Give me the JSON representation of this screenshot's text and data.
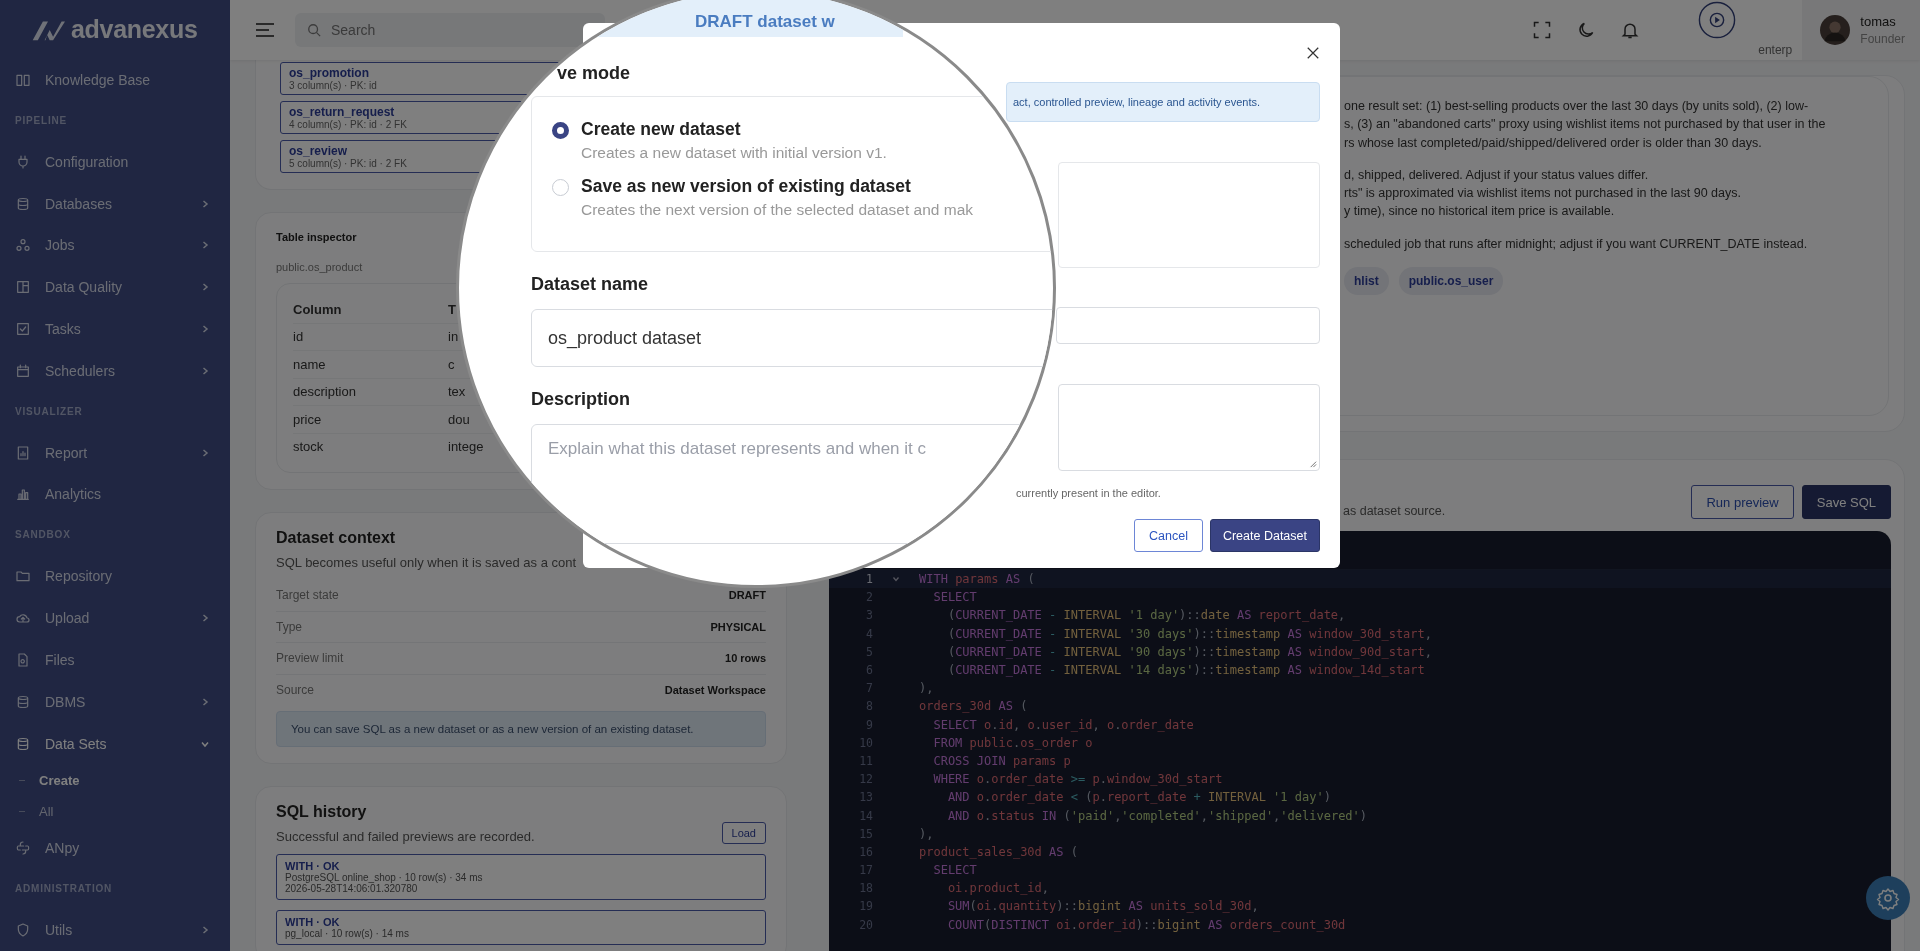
{
  "sidebar": {
    "logo": "advanexus",
    "items": [
      {
        "kind": "item",
        "label": "Knowledge Base",
        "submenu": false,
        "selected": false
      },
      {
        "kind": "section",
        "label": "PIPELINE"
      },
      {
        "kind": "item",
        "label": "Configuration",
        "submenu": false,
        "selected": false
      },
      {
        "kind": "item",
        "label": "Databases",
        "submenu": true,
        "expanded": false,
        "selected": false
      },
      {
        "kind": "item",
        "label": "Jobs",
        "submenu": true,
        "expanded": false,
        "selected": false
      },
      {
        "kind": "item",
        "label": "Data Quality",
        "submenu": true,
        "expanded": false,
        "selected": false
      },
      {
        "kind": "item",
        "label": "Tasks",
        "submenu": true,
        "expanded": false,
        "selected": false
      },
      {
        "kind": "item",
        "label": "Schedulers",
        "submenu": true,
        "expanded": false,
        "selected": false
      },
      {
        "kind": "section",
        "label": "VISUALIZER"
      },
      {
        "kind": "item",
        "label": "Report",
        "submenu": true,
        "expanded": false,
        "selected": false
      },
      {
        "kind": "item",
        "label": "Analytics",
        "submenu": false,
        "selected": false
      },
      {
        "kind": "section",
        "label": "SANDBOX"
      },
      {
        "kind": "item",
        "label": "Repository",
        "submenu": false,
        "selected": false
      },
      {
        "kind": "item",
        "label": "Upload",
        "submenu": true,
        "expanded": false,
        "selected": false
      },
      {
        "kind": "item",
        "label": "Files",
        "submenu": false,
        "selected": false
      },
      {
        "kind": "item",
        "label": "DBMS",
        "submenu": true,
        "expanded": false,
        "selected": false
      },
      {
        "kind": "item",
        "label": "Data Sets",
        "submenu": true,
        "expanded": true,
        "selected": true
      },
      {
        "kind": "subitem",
        "label": "Create",
        "selected": true
      },
      {
        "kind": "subitem",
        "label": "All",
        "selected": false
      },
      {
        "kind": "item",
        "label": "ANpy",
        "submenu": false,
        "selected": false
      },
      {
        "kind": "section",
        "label": "ADMINISTRATION"
      },
      {
        "kind": "item",
        "label": "Utils",
        "submenu": true,
        "expanded": false,
        "selected": false
      }
    ]
  },
  "topbar": {
    "search_placeholder": "Search",
    "plan": "enterp",
    "user": {
      "name": "tomas",
      "role": "Founder"
    }
  },
  "tables": [
    {
      "name": "os_promotion",
      "meta": "3 column(s) · PK: id"
    },
    {
      "name": "os_return_request",
      "meta": "4 column(s) · PK: id · 2 FK"
    },
    {
      "name": "os_review",
      "meta": "5 column(s) · PK: id · 2 FK"
    }
  ],
  "inspector": {
    "title": "Table inspector",
    "table": "public.os_product",
    "columns": [
      "Column",
      "T"
    ],
    "rows": [
      [
        "id",
        "in"
      ],
      [
        "name",
        "c"
      ],
      [
        "description",
        "tex"
      ],
      [
        "price",
        "dou"
      ],
      [
        "stock",
        "intege"
      ]
    ]
  },
  "context": {
    "title": "Dataset context",
    "text": "SQL becomes useful only when it is saved as a cont",
    "rows": [
      {
        "label": "Target state",
        "value": "DRAFT"
      },
      {
        "label": "Type",
        "value": "PHYSICAL"
      },
      {
        "label": "Preview limit",
        "value": "10 rows"
      },
      {
        "label": "Source",
        "value": "Dataset Workspace"
      }
    ],
    "note": "You can save SQL as a new dataset or as a new version of an existing dataset."
  },
  "history": {
    "title": "SQL history",
    "text": "Successful and failed previews are recorded.",
    "load": "Load",
    "entries": [
      {
        "title": "WITH · OK",
        "lines": [
          "PostgreSQL online_shop · 10 row(s) · 34 ms",
          "2026-05-28T14:06:01.320780"
        ]
      },
      {
        "title": "WITH · OK",
        "lines": [
          "pg_local · 10 row(s) · 14 ms"
        ]
      }
    ]
  },
  "description": {
    "paragraphs": [
      [
        "one result set: (1) best-selling products over the last 30 days (by units sold), (2) low-",
        "s, (3) an \"abandoned carts\" proxy using wishlist items not purchased by that user in the",
        "rs whose last completed/paid/shipped/delivered order is older than 30 days."
      ],
      [
        "d, shipped, delivered. Adjust if your status values differ.",
        "rts\" is approximated via wishlist items not purchased in the last 90 days.",
        "y time), since no historical item price is available."
      ],
      [
        "scheduled job that runs after midnight; adjust if you want CURRENT_DATE instead."
      ]
    ],
    "tags": [
      "hlist",
      "public.os_user"
    ]
  },
  "sql": {
    "text": "as dataset source.",
    "buttons": [
      {
        "label": "Run preview",
        "kind": "secondary"
      },
      {
        "label": "Save SQL",
        "kind": "primary"
      }
    ]
  },
  "editor": {
    "lines": [
      {
        "n": "1",
        "current": true,
        "seg": [
          {
            "kind": "keyword",
            "text": "WITH"
          },
          {
            "kind": "identifier",
            "text": " params"
          },
          {
            "kind": "keyword",
            "text": " AS"
          },
          {
            "kind": "punctuation",
            "text": " ("
          }
        ]
      },
      {
        "n": "2",
        "current": false,
        "seg": [
          {
            "kind": "keyword",
            "text": "  SELECT"
          }
        ]
      },
      {
        "n": "3",
        "current": false,
        "seg": [
          {
            "kind": "punctuation",
            "text": "    ("
          },
          {
            "kind": "keyword",
            "text": "CURRENT_DATE"
          },
          {
            "kind": "operator",
            "text": " - "
          },
          {
            "kind": "type",
            "text": "INTERVAL"
          },
          {
            "kind": "string",
            "text": " '1 day'"
          },
          {
            "kind": "punctuation",
            "text": ")::"
          },
          {
            "kind": "type",
            "text": "date"
          },
          {
            "kind": "keyword",
            "text": " AS"
          },
          {
            "kind": "identifier",
            "text": " report_date"
          },
          {
            "kind": "punctuation",
            "text": ","
          }
        ]
      },
      {
        "n": "4",
        "current": false,
        "seg": [
          {
            "kind": "punctuation",
            "text": "    ("
          },
          {
            "kind": "keyword",
            "text": "CURRENT_DATE"
          },
          {
            "kind": "operator",
            "text": " - "
          },
          {
            "kind": "type",
            "text": "INTERVAL"
          },
          {
            "kind": "string",
            "text": " '30 days'"
          },
          {
            "kind": "punctuation",
            "text": ")::"
          },
          {
            "kind": "type",
            "text": "timestamp"
          },
          {
            "kind": "keyword",
            "text": " AS"
          },
          {
            "kind": "identifier",
            "text": " window_30d_start"
          },
          {
            "kind": "punctuation",
            "text": ","
          }
        ]
      },
      {
        "n": "5",
        "current": false,
        "seg": [
          {
            "kind": "punctuation",
            "text": "    ("
          },
          {
            "kind": "keyword",
            "text": "CURRENT_DATE"
          },
          {
            "kind": "operator",
            "text": " - "
          },
          {
            "kind": "type",
            "text": "INTERVAL"
          },
          {
            "kind": "string",
            "text": " '90 days'"
          },
          {
            "kind": "punctuation",
            "text": ")::"
          },
          {
            "kind": "type",
            "text": "timestamp"
          },
          {
            "kind": "keyword",
            "text": " AS"
          },
          {
            "kind": "identifier",
            "text": " window_90d_start"
          },
          {
            "kind": "punctuation",
            "text": ","
          }
        ]
      },
      {
        "n": "6",
        "current": false,
        "seg": [
          {
            "kind": "punctuation",
            "text": "    ("
          },
          {
            "kind": "keyword",
            "text": "CURRENT_DATE"
          },
          {
            "kind": "operator",
            "text": " - "
          },
          {
            "kind": "type",
            "text": "INTERVAL"
          },
          {
            "kind": "string",
            "text": " '14 days'"
          },
          {
            "kind": "punctuation",
            "text": ")::"
          },
          {
            "kind": "type",
            "text": "timestamp"
          },
          {
            "kind": "keyword",
            "text": " AS"
          },
          {
            "kind": "identifier",
            "text": " window_14d_start"
          }
        ]
      },
      {
        "n": "7",
        "current": false,
        "seg": [
          {
            "kind": "punctuation",
            "text": "),"
          }
        ]
      },
      {
        "n": "8",
        "current": false,
        "seg": [
          {
            "kind": "identifier",
            "text": "orders_30d"
          },
          {
            "kind": "keyword",
            "text": " AS"
          },
          {
            "kind": "punctuation",
            "text": " ("
          }
        ]
      },
      {
        "n": "9",
        "current": false,
        "seg": [
          {
            "kind": "keyword",
            "text": "  SELECT"
          },
          {
            "kind": "identifier",
            "text": " o"
          },
          {
            "kind": "punctuation",
            "text": "."
          },
          {
            "kind": "identifier",
            "text": "id"
          },
          {
            "kind": "punctuation",
            "text": ", "
          },
          {
            "kind": "identifier",
            "text": "o"
          },
          {
            "kind": "punctuation",
            "text": "."
          },
          {
            "kind": "identifier",
            "text": "user_id"
          },
          {
            "kind": "punctuation",
            "text": ", "
          },
          {
            "kind": "identifier",
            "text": "o"
          },
          {
            "kind": "punctuation",
            "text": "."
          },
          {
            "kind": "identifier",
            "text": "order_date"
          }
        ]
      },
      {
        "n": "10",
        "current": false,
        "seg": [
          {
            "kind": "keyword",
            "text": "  FROM"
          },
          {
            "kind": "identifier",
            "text": " public"
          },
          {
            "kind": "punctuation",
            "text": "."
          },
          {
            "kind": "identifier",
            "text": "os_order o"
          }
        ]
      },
      {
        "n": "11",
        "current": false,
        "seg": [
          {
            "kind": "keyword",
            "text": "  CROSS JOIN"
          },
          {
            "kind": "identifier",
            "text": " params p"
          }
        ]
      },
      {
        "n": "12",
        "current": false,
        "seg": [
          {
            "kind": "keyword",
            "text": "  WHERE"
          },
          {
            "kind": "identifier",
            "text": " o"
          },
          {
            "kind": "punctuation",
            "text": "."
          },
          {
            "kind": "identifier",
            "text": "order_date"
          },
          {
            "kind": "operator",
            "text": " >= "
          },
          {
            "kind": "identifier",
            "text": "p"
          },
          {
            "kind": "punctuation",
            "text": "."
          },
          {
            "kind": "identifier",
            "text": "window_30d_start"
          }
        ]
      },
      {
        "n": "13",
        "current": false,
        "seg": [
          {
            "kind": "keyword",
            "text": "    AND"
          },
          {
            "kind": "identifier",
            "text": " o"
          },
          {
            "kind": "punctuation",
            "text": "."
          },
          {
            "kind": "identifier",
            "text": "order_date"
          },
          {
            "kind": "operator",
            "text": " < "
          },
          {
            "kind": "punctuation",
            "text": "("
          },
          {
            "kind": "identifier",
            "text": "p"
          },
          {
            "kind": "punctuation",
            "text": "."
          },
          {
            "kind": "identifier",
            "text": "report_date"
          },
          {
            "kind": "operator",
            "text": " + "
          },
          {
            "kind": "type",
            "text": "INTERVAL"
          },
          {
            "kind": "string",
            "text": " '1 day'"
          },
          {
            "kind": "punctuation",
            "text": ")"
          }
        ]
      },
      {
        "n": "14",
        "current": false,
        "seg": [
          {
            "kind": "keyword",
            "text": "    AND"
          },
          {
            "kind": "identifier",
            "text": " o"
          },
          {
            "kind": "punctuation",
            "text": "."
          },
          {
            "kind": "identifier",
            "text": "status"
          },
          {
            "kind": "keyword",
            "text": " IN"
          },
          {
            "kind": "punctuation",
            "text": " ("
          },
          {
            "kind": "string",
            "text": "'paid'"
          },
          {
            "kind": "punctuation",
            "text": ","
          },
          {
            "kind": "string",
            "text": "'completed'"
          },
          {
            "kind": "punctuation",
            "text": ","
          },
          {
            "kind": "string",
            "text": "'shipped'"
          },
          {
            "kind": "punctuation",
            "text": ","
          },
          {
            "kind": "string",
            "text": "'delivered'"
          },
          {
            "kind": "punctuation",
            "text": ")"
          }
        ]
      },
      {
        "n": "15",
        "current": false,
        "seg": [
          {
            "kind": "punctuation",
            "text": "),"
          }
        ]
      },
      {
        "n": "16",
        "current": false,
        "seg": [
          {
            "kind": "identifier",
            "text": "product_sales_30d"
          },
          {
            "kind": "keyword",
            "text": " AS"
          },
          {
            "kind": "punctuation",
            "text": " ("
          }
        ]
      },
      {
        "n": "17",
        "current": false,
        "seg": [
          {
            "kind": "keyword",
            "text": "  SELECT"
          }
        ]
      },
      {
        "n": "18",
        "current": false,
        "seg": [
          {
            "kind": "identifier",
            "text": "    oi.product_id"
          },
          {
            "kind": "punctuation",
            "text": ","
          }
        ]
      },
      {
        "n": "19",
        "current": false,
        "seg": [
          {
            "kind": "keyword",
            "text": "    SUM"
          },
          {
            "kind": "punctuation",
            "text": "("
          },
          {
            "kind": "identifier",
            "text": "oi"
          },
          {
            "kind": "punctuation",
            "text": "."
          },
          {
            "kind": "identifier",
            "text": "quantity"
          },
          {
            "kind": "punctuation",
            "text": ")::"
          },
          {
            "kind": "type",
            "text": "bigint"
          },
          {
            "kind": "keyword",
            "text": " AS"
          },
          {
            "kind": "identifier",
            "text": " units_sold_30d"
          },
          {
            "kind": "punctuation",
            "text": ","
          }
        ]
      },
      {
        "n": "20",
        "current": false,
        "seg": [
          {
            "kind": "keyword",
            "text": "    COUNT"
          },
          {
            "kind": "punctuation",
            "text": "("
          },
          {
            "kind": "keyword",
            "text": "DISTINCT"
          },
          {
            "kind": "identifier",
            "text": " oi"
          },
          {
            "kind": "punctuation",
            "text": "."
          },
          {
            "kind": "identifier",
            "text": "order_id"
          },
          {
            "kind": "punctuation",
            "text": ")::"
          },
          {
            "kind": "type",
            "text": "bigint"
          },
          {
            "kind": "keyword",
            "text": " AS"
          },
          {
            "kind": "identifier",
            "text": " orders_count_30d"
          }
        ]
      }
    ]
  },
  "modal": {
    "info": "act, controlled preview, lineage and activity events.",
    "hint": "currently present in the editor.",
    "buttons": [
      {
        "label": "Cancel",
        "kind": "secondary"
      },
      {
        "label": "Create Dataset",
        "kind": "primary"
      }
    ]
  },
  "magnifier": {
    "banner": "DRAFT dataset w",
    "mode_label": "ve mode",
    "options": [
      {
        "title": "Create new dataset",
        "hint": "Creates a new dataset with initial version v1.",
        "selected": true
      },
      {
        "title": "Save as new version of existing dataset",
        "hint": "Creates the next version of the selected dataset and mak",
        "selected": false
      }
    ],
    "name_label": "Dataset name",
    "name_value": "os_product dataset",
    "desc_label": "Description",
    "desc_placeholder": "Explain what this dataset represents and when it c"
  }
}
